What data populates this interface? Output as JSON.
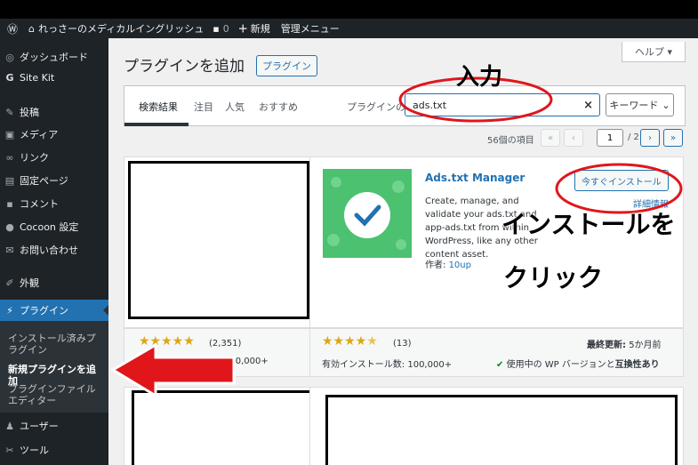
{
  "adminbar": {
    "site_name": "れっさーのメディカルイングリッシュ",
    "comments_count": "0",
    "new_label": "新規",
    "admin_menu_label": "管理メニュー"
  },
  "sidebar": {
    "items": [
      {
        "label": "ダッシュボード",
        "icon": "dashboard-icon"
      },
      {
        "label": "Site Kit",
        "icon": "sitekit-icon"
      },
      {
        "label": "投稿",
        "icon": "pin-icon"
      },
      {
        "label": "メディア",
        "icon": "media-icon"
      },
      {
        "label": "リンク",
        "icon": "link-icon"
      },
      {
        "label": "固定ページ",
        "icon": "page-icon"
      },
      {
        "label": "コメント",
        "icon": "comment-icon"
      },
      {
        "label": "Cocoon 設定",
        "icon": "cocoon-icon"
      },
      {
        "label": "お問い合わせ",
        "icon": "mail-icon"
      },
      {
        "label": "外観",
        "icon": "brush-icon"
      },
      {
        "label": "プラグイン",
        "icon": "plugin-icon"
      },
      {
        "label": "ユーザー",
        "icon": "user-icon"
      },
      {
        "label": "ツール",
        "icon": "wrench-icon"
      }
    ],
    "submenu": {
      "installed": "インストール済みプラグイン",
      "add_new": "新規プラグインを追加",
      "editor": "プラグインファイルエディター"
    }
  },
  "header": {
    "help": "ヘルプ ▾",
    "title": "プラグインを追加",
    "upload_button": "プラグイン"
  },
  "filter": {
    "tabs": [
      "検索結果",
      "注目",
      "人気",
      "おすすめ"
    ],
    "search_label": "プラグインの検索",
    "search_value": "ads.txt",
    "search_type": "キーワード"
  },
  "pagination": {
    "item_count": "56個の項目",
    "current_page": "1",
    "total_pages": "/ 2"
  },
  "plugin": {
    "name": "Ads.txt Manager",
    "description": "Create, manage, and validate your ads.txt and app-ads.txt from within WordPress, like any other content asset.",
    "author_label": "作者:",
    "author": "10up",
    "install_button": "今すぐインストール",
    "details_link": "詳細情報",
    "rating_count": "(13)",
    "last_updated_label": "最終更新:",
    "last_updated": "5か月前",
    "active_installs": "有効インストール数: 100,000+",
    "compat_prefix": "使用中の WP バージョンと",
    "compat_bold": "互換性あり",
    "rating": 4.5
  },
  "left_card": {
    "rating_count": "(2,351)",
    "installs_partial": "100,000+",
    "rating": 5
  },
  "annotations": {
    "input_label": "入力",
    "click_line1": "インストールを",
    "click_line2": "クリック"
  },
  "colors": {
    "accent": "#2271b1",
    "star": "#dba617",
    "annotation_red": "#e0161b",
    "admin_dark": "#1d2327"
  }
}
